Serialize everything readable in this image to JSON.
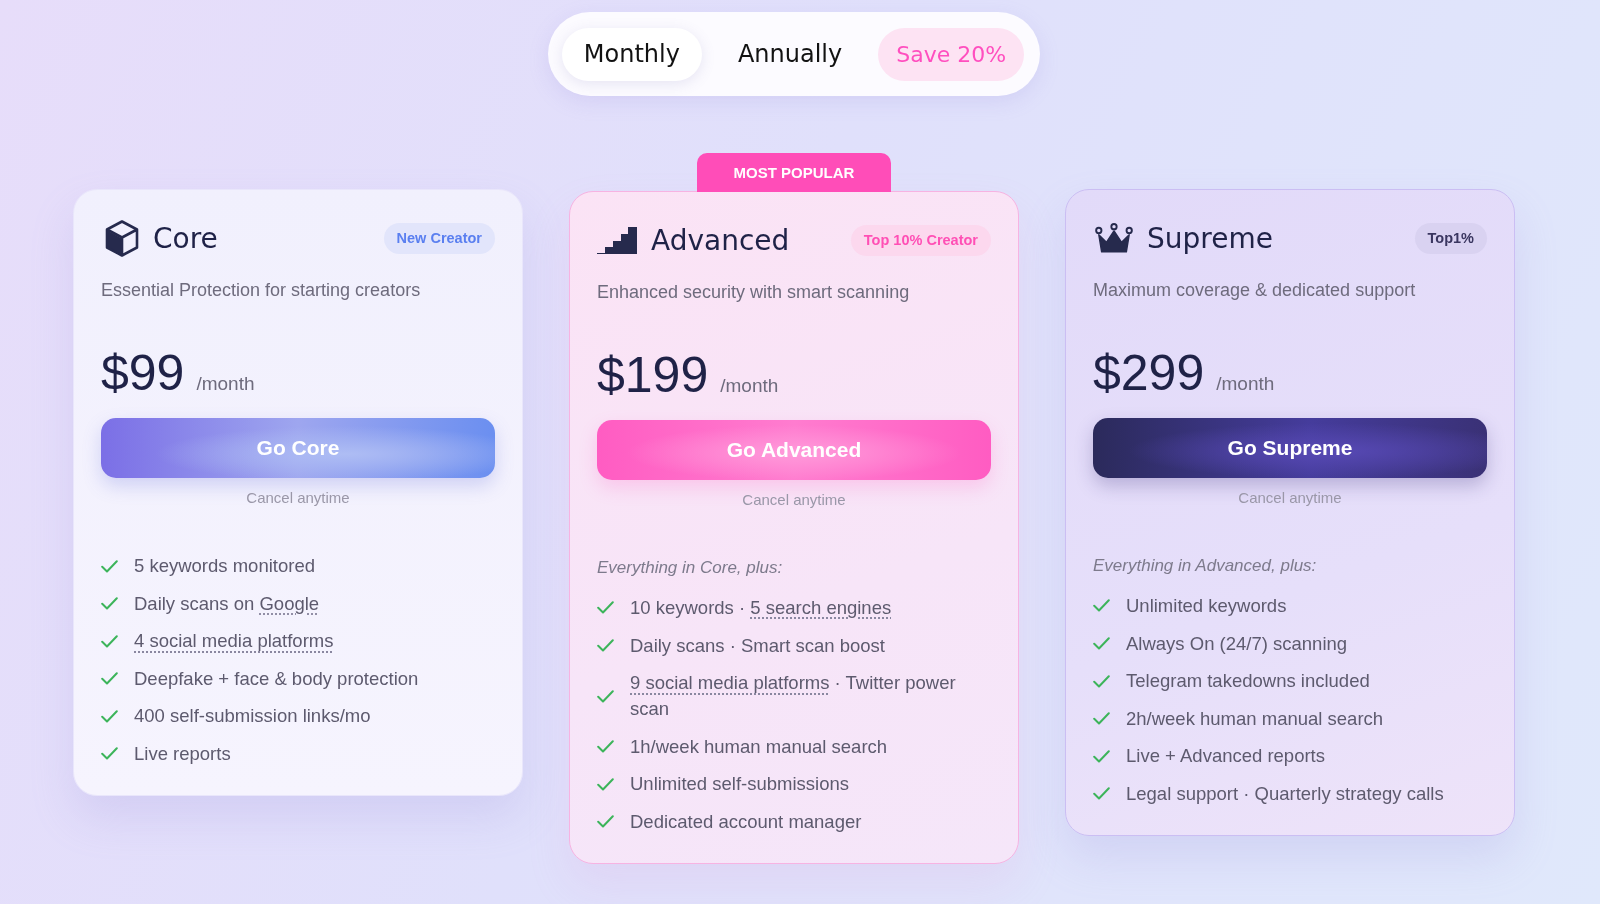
{
  "billing_toggle": {
    "options": [
      {
        "label": "Monthly",
        "selected": true
      },
      {
        "label": "Annually",
        "selected": false
      }
    ],
    "discount_badge": "Save 20%"
  },
  "plans": [
    {
      "kind": "standard",
      "name": "Core",
      "badge": "New Creator",
      "description": "Essential Protection for starting creators",
      "price": "$99",
      "period": "/month",
      "button": "Go Core",
      "note": "Cancel anytime",
      "features": [
        {
          "parts": [
            {
              "kind": "plain",
              "text": "5 keywords monitored"
            }
          ]
        },
        {
          "parts": [
            {
              "kind": "plain",
              "text": "Daily scans on "
            },
            {
              "kind": "term",
              "text": "Google"
            }
          ]
        },
        {
          "parts": [
            {
              "kind": "term",
              "text": "4 social media platforms"
            }
          ]
        },
        {
          "parts": [
            {
              "kind": "plain",
              "text": "Deepfake + face & body protection"
            }
          ]
        },
        {
          "parts": [
            {
              "kind": "plain",
              "text": "400 self-submission links/mo"
            }
          ]
        },
        {
          "parts": [
            {
              "kind": "plain",
              "text": "Live reports"
            }
          ]
        }
      ]
    },
    {
      "kind": "popular",
      "ribbon": "MOST POPULAR",
      "name": "Advanced",
      "badge": "Top 10% Creator",
      "description": "Enhanced security with smart scanning",
      "price": "$199",
      "period": "/month",
      "button": "Go Advanced",
      "note": "Cancel anytime",
      "intro": "Everything in Core, plus:",
      "features": [
        {
          "parts": [
            {
              "kind": "plain",
              "text": "10 keywords · "
            },
            {
              "kind": "term",
              "text": "5 search engines"
            }
          ]
        },
        {
          "parts": [
            {
              "kind": "plain",
              "text": "Daily scans · Smart scan boost"
            }
          ]
        },
        {
          "parts": [
            {
              "kind": "term",
              "text": "9 social media platforms"
            },
            {
              "kind": "plain",
              "text": " · Twitter power scan"
            }
          ]
        },
        {
          "parts": [
            {
              "kind": "plain",
              "text": "1h/week human manual search"
            }
          ]
        },
        {
          "parts": [
            {
              "kind": "plain",
              "text": "Unlimited self-submissions"
            }
          ]
        },
        {
          "parts": [
            {
              "kind": "plain",
              "text": "Dedicated account manager"
            }
          ]
        }
      ]
    },
    {
      "kind": "premium",
      "name": "Supreme",
      "badge": "Top1%",
      "description": "Maximum coverage & dedicated support",
      "price": "$299",
      "period": "/month",
      "button": "Go Supreme",
      "note": "Cancel anytime",
      "intro": "Everything in Advanced, plus:",
      "features": [
        {
          "parts": [
            {
              "kind": "plain",
              "text": "Unlimited keywords"
            }
          ]
        },
        {
          "parts": [
            {
              "kind": "plain",
              "text": "Always On (24/7) scanning"
            }
          ]
        },
        {
          "parts": [
            {
              "kind": "plain",
              "text": "Telegram takedowns included"
            }
          ]
        },
        {
          "parts": [
            {
              "kind": "plain",
              "text": "2h/week human manual search"
            }
          ]
        },
        {
          "parts": [
            {
              "kind": "plain",
              "text": "Live + Advanced reports"
            }
          ]
        },
        {
          "parts": [
            {
              "kind": "plain",
              "text": "Legal support · Quarterly strategy calls"
            }
          ]
        }
      ]
    }
  ]
}
